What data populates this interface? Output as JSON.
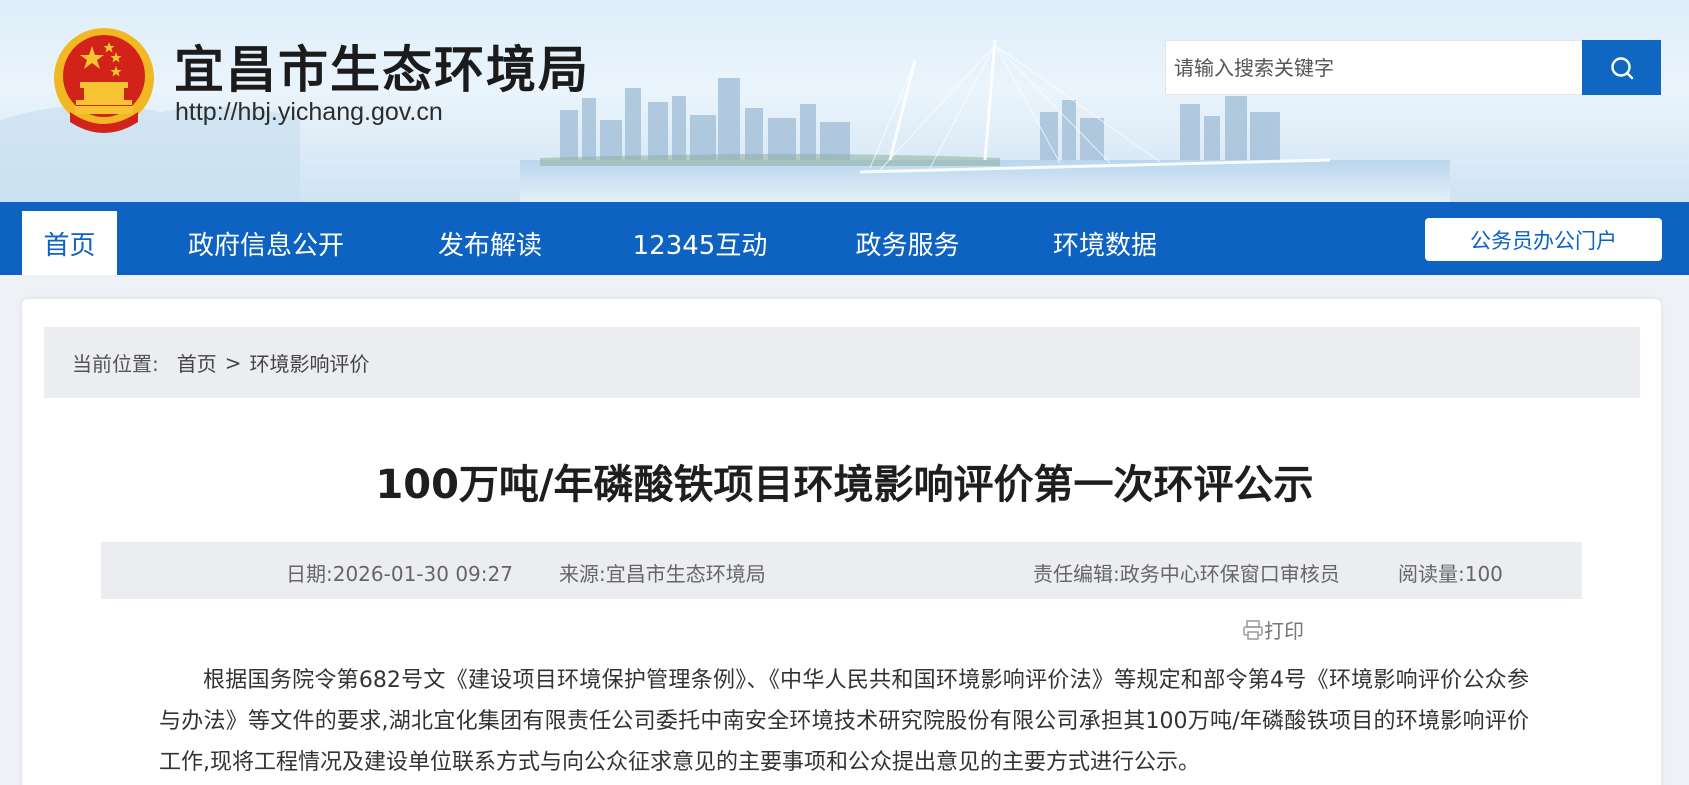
{
  "site": {
    "title": "宜昌市生态环境局",
    "url": "http://hbj.yichang.gov.cn"
  },
  "search": {
    "placeholder": "请输入搜索关键字",
    "icon": "search-icon"
  },
  "nav": {
    "items": [
      {
        "label": "首页",
        "active": true
      },
      {
        "label": "政府信息公开",
        "active": false
      },
      {
        "label": "发布解读",
        "active": false
      },
      {
        "label": "12345互动",
        "active": false
      },
      {
        "label": "政务服务",
        "active": false
      },
      {
        "label": "环境数据",
        "active": false
      }
    ],
    "portal_label": "公务员办公门户"
  },
  "breadcrumb": {
    "prefix": "当前位置:",
    "items": [
      "首页",
      "环境影响评价"
    ],
    "separator": ">"
  },
  "article": {
    "title": "100万吨/年磷酸铁项目环境影响评价第一次环评公示",
    "date": "日期:2026-01-30 09:27",
    "source": "来源:宜昌市生态环境局",
    "editor": "责任编辑:政务中心环保窗口审核员",
    "views": "阅读量:100",
    "print_label": "打印",
    "body": "根据国务院令第682号文《建设项目环境保护管理条例》、《中华人民共和国环境影响评价法》等规定和部令第4号《环境影响评价公众参与办法》等文件的要求,湖北宜化集团有限责任公司委托中南安全环境技术研究院股份有限公司承担其100万吨/年磷酸铁项目的环境影响评价工作,现将工程情况及建设单位联系方式与向公众征求意见的主要事项和公众提出意见的主要方式进行公示。"
  },
  "colors": {
    "brand_blue": "#0d62c2",
    "emblem_red": "#d2231b",
    "emblem_gold": "#f6c431"
  }
}
